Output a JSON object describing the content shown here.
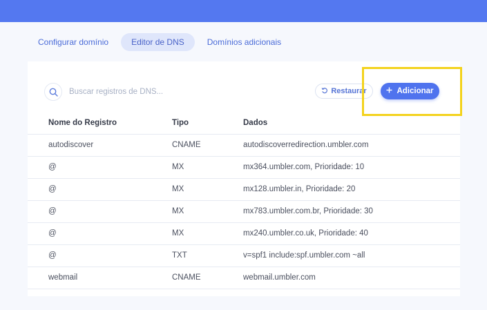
{
  "tabs": [
    {
      "label": "Configurar domínio",
      "active": false
    },
    {
      "label": "Editor de DNS",
      "active": true
    },
    {
      "label": "Domínios adicionais",
      "active": false
    }
  ],
  "search": {
    "placeholder": "Buscar registros de DNS..."
  },
  "toolbar": {
    "restore_label": "Restaurar",
    "add_label": "Adicionar"
  },
  "table": {
    "headers": [
      "Nome do Registro",
      "Tipo",
      "Dados"
    ],
    "rows": [
      [
        "autodiscover",
        "CNAME",
        "autodiscoverredirection.umbler.com"
      ],
      [
        "@",
        "MX",
        "mx364.umbler.com, Prioridade: 10"
      ],
      [
        "@",
        "MX",
        "mx128.umbler.in, Prioridade: 20"
      ],
      [
        "@",
        "MX",
        "mx783.umbler.com.br, Prioridade: 30"
      ],
      [
        "@",
        "MX",
        "mx240.umbler.co.uk, Prioridade: 40"
      ],
      [
        "@",
        "TXT",
        "v=spf1 include:spf.umbler.com ~all"
      ],
      [
        "webmail",
        "CNAME",
        "webmail.umbler.com"
      ]
    ]
  },
  "colors": {
    "topbar": "#5478f0",
    "accent": "#4f73ee",
    "highlight": "#f3d21b"
  },
  "icons": {
    "search": "search-icon",
    "restore": "undo-icon",
    "add": "plus-icon"
  }
}
